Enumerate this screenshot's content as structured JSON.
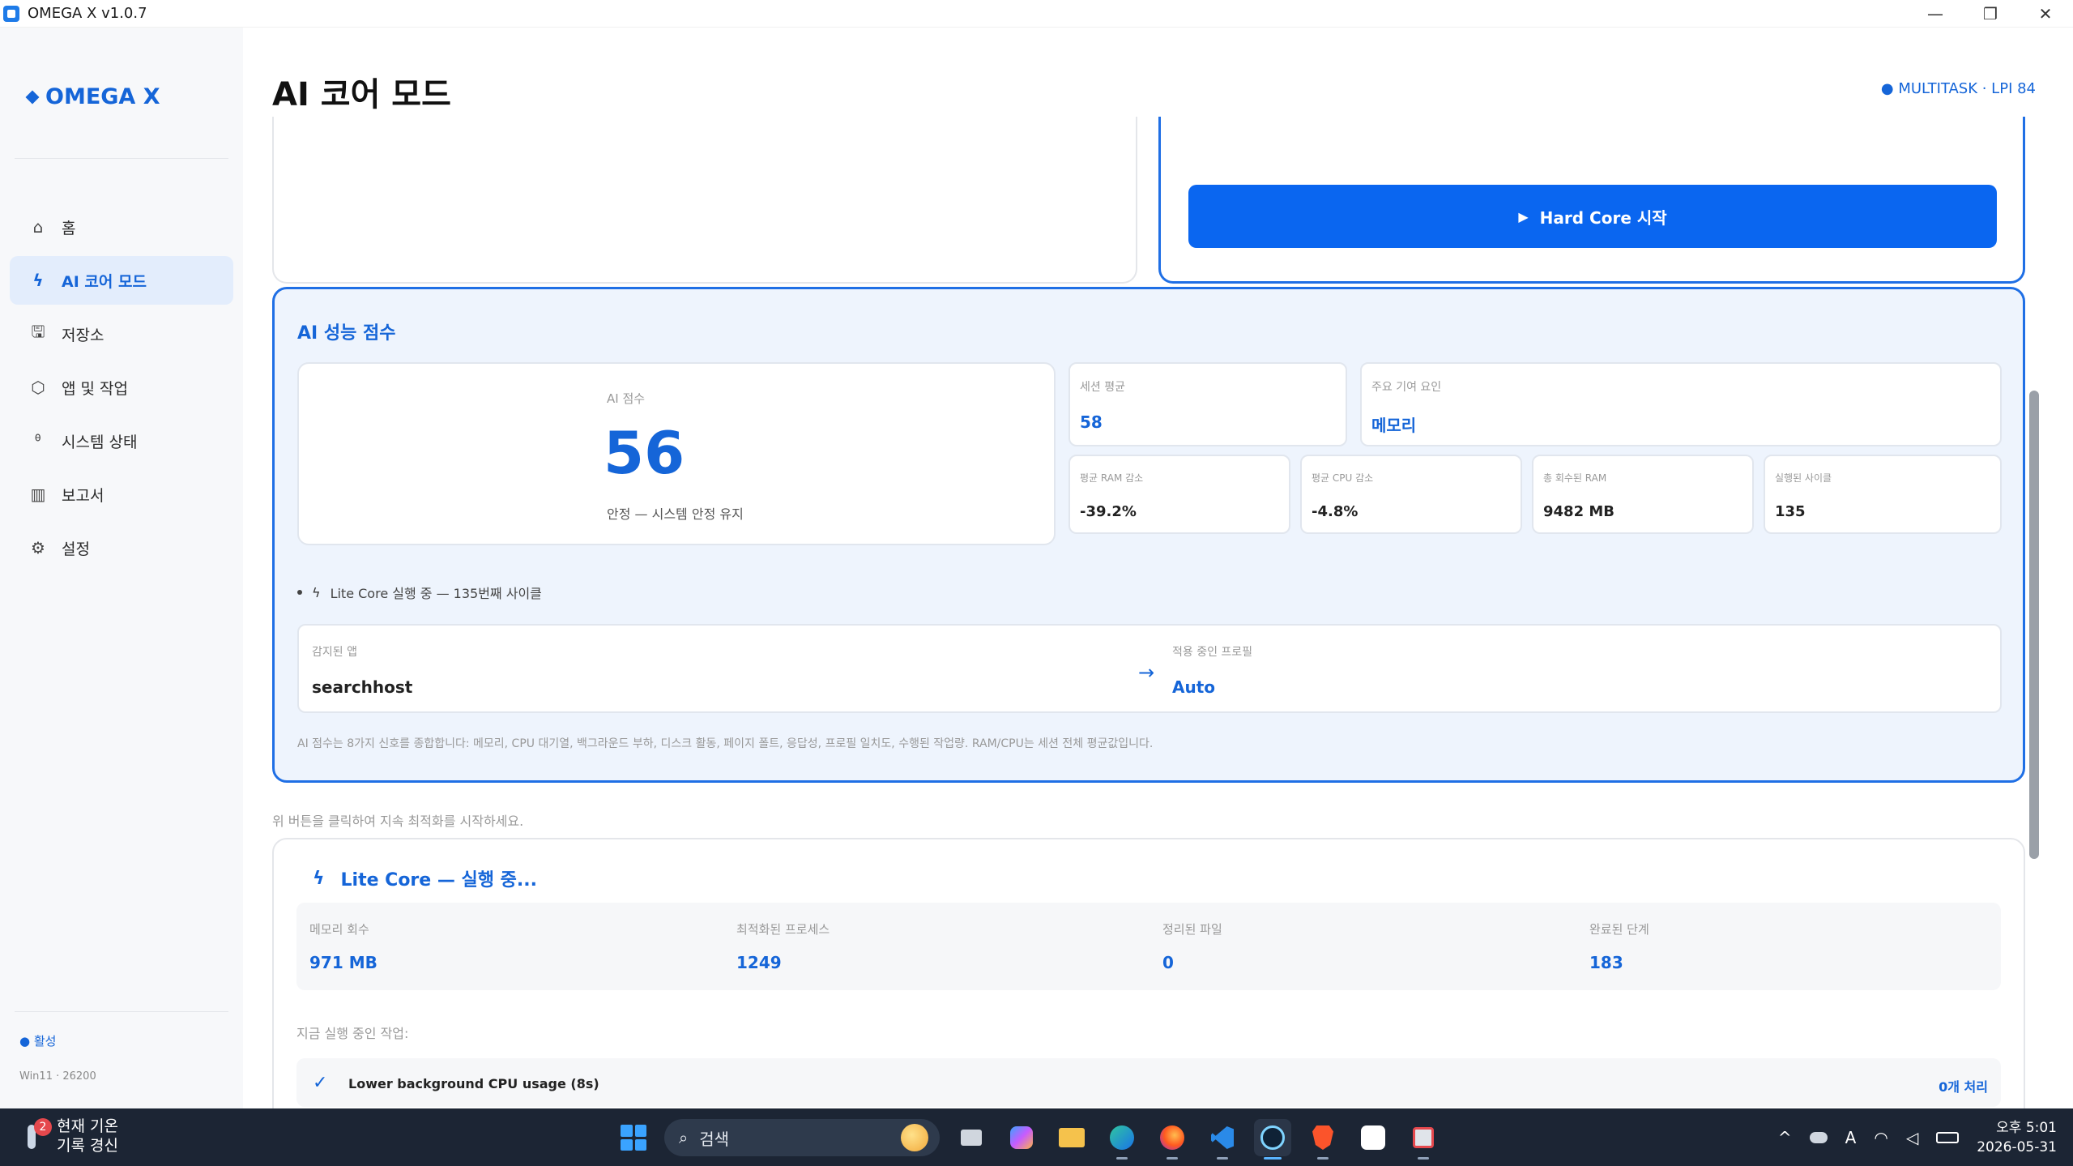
{
  "window": {
    "title": "OMEGA X v1.0.7",
    "minimize": "—",
    "restore": "❐",
    "close": "✕"
  },
  "sidebar": {
    "brand": "OMEGA X",
    "items": [
      {
        "label": "홈",
        "icon": "home-icon",
        "glyph": "⌂"
      },
      {
        "label": "AI 코어 모드",
        "icon": "lightning-icon",
        "glyph": "ϟ"
      },
      {
        "label": "저장소",
        "icon": "save-icon",
        "glyph": "🖫"
      },
      {
        "label": "앱 및 작업",
        "icon": "package-icon",
        "glyph": "⬡"
      },
      {
        "label": "시스템 상태",
        "icon": "stethoscope-icon",
        "glyph": "ᶿ"
      },
      {
        "label": "보고서",
        "icon": "report-icon",
        "glyph": "▥"
      },
      {
        "label": "설정",
        "icon": "gear-icon",
        "glyph": "⚙"
      }
    ],
    "status": "● 활성",
    "build": "Win11 · 26200"
  },
  "header": {
    "title": "AI 코어 모드",
    "badge": "● MULTITASK · LPI 84"
  },
  "hardcore": {
    "button_label": "Hard Core 시작",
    "play_glyph": "▶"
  },
  "ai_score": {
    "title": "AI 성능 점수",
    "score_label": "AI 점수",
    "score_value": "56",
    "score_desc": "안정 — 시스템 안정 유지",
    "session_avg_label": "세션 평균",
    "session_avg_value": "58",
    "main_factor_label": "주요 기여 요인",
    "main_factor_value": "메모리",
    "ram_label": "평균 RAM 감소",
    "ram_value": "-39.2%",
    "cpu_label": "평균 CPU 감소",
    "cpu_value": "-4.8%",
    "reclaimed_label": "총 회수된 RAM",
    "reclaimed_value": "9482 MB",
    "cycles_label": "실행된 사이클",
    "cycles_value": "135",
    "running_line": "Lite Core 실행 중 — 135번째 사이클",
    "detected_app_label": "감지된 앱",
    "detected_app_value": "searchhost",
    "arrow": "→",
    "profile_label": "적용 중인 프로필",
    "profile_value": "Auto",
    "footnote": "AI 점수는 8가지 신호를 종합합니다: 메모리, CPU 대기열, 백그라운드 부하, 디스크 활동, 페이지 폴트, 응답성, 프로필 일치도, 수행된 작업량. RAM/CPU는 세션 전체 평균값입니다."
  },
  "hint": "위 버튼을 클릭하여 지속 최적화를 시작하세요.",
  "lite_core": {
    "title": "Lite Core — 실행 중...",
    "stats": [
      {
        "label": "메모리 회수",
        "value": "971 MB"
      },
      {
        "label": "최적화된 프로세스",
        "value": "1249"
      },
      {
        "label": "정리된 파일",
        "value": "0"
      },
      {
        "label": "완료된 단계",
        "value": "183"
      }
    ],
    "tasks_label": "지금 실행 중인 작업:",
    "task": {
      "check": "✓",
      "label": "Lower background CPU usage (8s)",
      "count": "0개 처리"
    }
  },
  "taskbar": {
    "weather_badge": "2",
    "weather_line1": "현재 기온",
    "weather_line2": "기록 경신",
    "search_placeholder": "검색",
    "search_glyph": "⌕",
    "tray_chevron": "^",
    "tray_ime": "A",
    "time": "오후 5:01",
    "date": "2026-05-31"
  },
  "colors": {
    "accent": "#1565d8",
    "button": "#0a66f0",
    "panel_bg": "#eef4fd",
    "taskbar": "#1c2534"
  }
}
